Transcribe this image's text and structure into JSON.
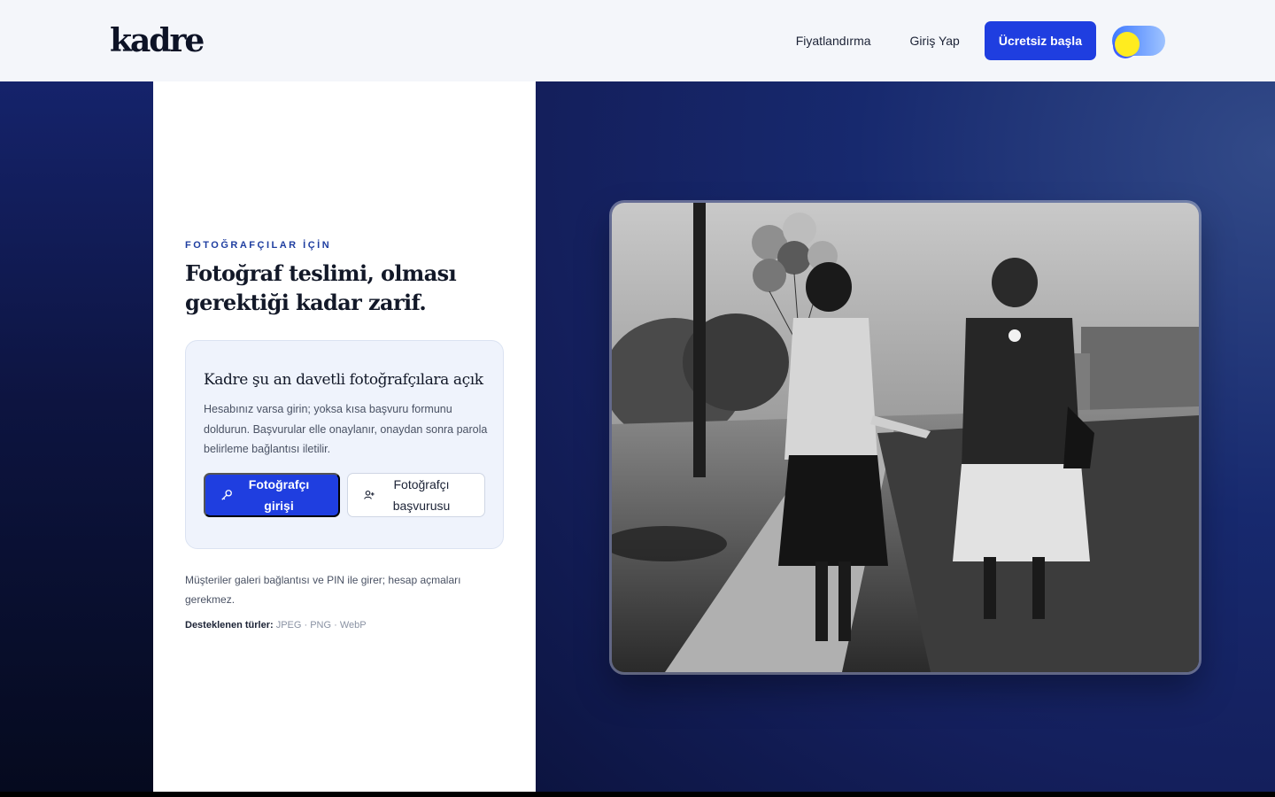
{
  "header": {
    "logo": "kadre",
    "nav": {
      "pricing": "Fiyatlandırma",
      "login": "Giriş Yap",
      "cta": "Ücretsiz başla"
    }
  },
  "panel": {
    "eyebrow": "FOTOĞRAFÇILAR İÇİN",
    "headline": "Fotoğraf teslimi, olması gerektiği kadar zarif.",
    "card": {
      "title": "Kadre şu an davetli fotoğrafçılara açık",
      "text": "Hesabınız varsa girin; yoksa kısa başvuru formunu doldurun. Başvurular elle onaylanır, onaydan sonra parola belirleme bağlantısı iletilir.",
      "primary_button": "Fotoğrafçı girişi",
      "secondary_button": "Fotoğrafçı başvurusu"
    },
    "footnote": "Müşteriler galeri bağlantısı ve PIN ile girer; hesap açmaları gerekmez.",
    "formats_label": "Desteklenen türler:",
    "formats_value": " JPEG · PNG · WebP"
  },
  "colors": {
    "accent": "#1f3ee0",
    "background_navy": "#141f5c"
  },
  "icons": {
    "primary_button": "key-icon",
    "secondary_button": "user-plus-icon",
    "theme_toggle": "sun-icon"
  }
}
